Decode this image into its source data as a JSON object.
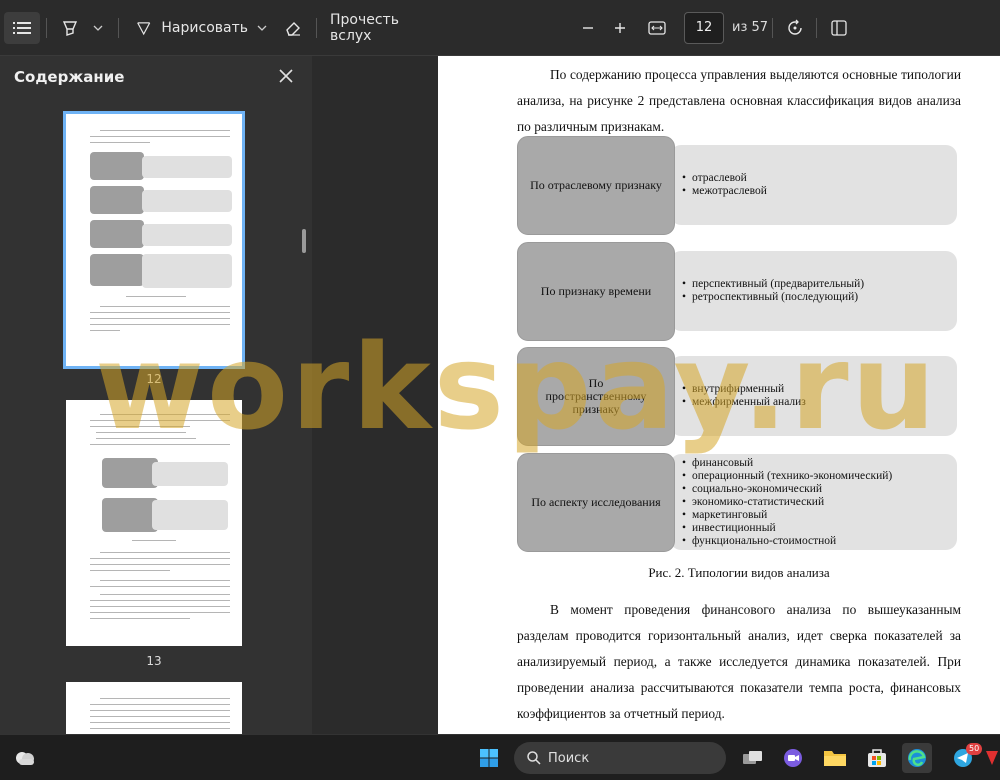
{
  "toolbar": {
    "draw_label": "Нарисовать",
    "read_aloud_label": "Прочесть вслух",
    "page_current": "12",
    "page_total": "из 57"
  },
  "sidebar": {
    "title": "Содержание",
    "thumbnails": [
      {
        "page": "12",
        "selected": true
      },
      {
        "page": "13",
        "selected": false
      }
    ]
  },
  "document": {
    "intro": "По содержанию процесса управления выделяются основные типологии анализа, на рисунке 2 представлена основная классификация видов анализа по различным признакам.",
    "rows": [
      {
        "label": "По отраслевому признаку",
        "items": [
          "отраслевой",
          "межотраслевой"
        ]
      },
      {
        "label": "По признаку времени",
        "items": [
          "перспективный (предварительный)",
          "ретроспективный (последующий)"
        ]
      },
      {
        "label": "По пространственному признаку",
        "items": [
          "внутрифирменный",
          "межфирменный анализ"
        ]
      },
      {
        "label": "По аспекту исследования",
        "items": [
          "финансовый",
          "операционный (технико-экономический)",
          "социально-экономический",
          "экономико-статистический",
          "маркетинговый",
          "инвестиционный",
          "функционально-стоимостной"
        ]
      }
    ],
    "caption": "Рис. 2. Типологии видов анализа",
    "conclusion": "В момент проведения финансового анализа по вышеуказанным разделам проводится горизонтальный анализ, идет сверка показателей за анализируемый период, а также исследуется динамика показателей. При проведении анализа рассчитываются показатели темпа роста, финансовых коэффициентов за отчетный период."
  },
  "watermark": "workspay.ru",
  "taskbar": {
    "search_label": "Поиск",
    "telegram_badge": "50"
  },
  "colors": {
    "accent": "#6fb3f5",
    "watermark": "#d6a628",
    "box_dark": "#a9a9a9",
    "box_light": "#e2e2e2"
  }
}
